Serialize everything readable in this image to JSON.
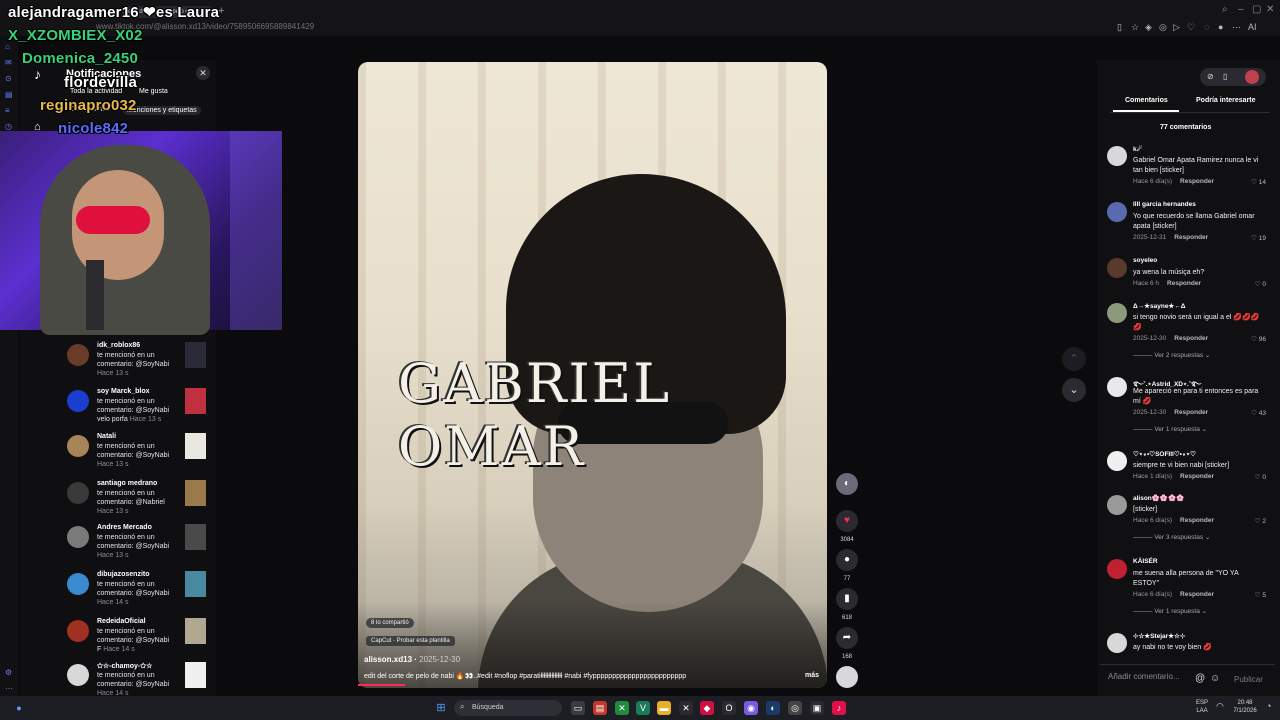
{
  "browser": {
    "url": "www.tiktok.com/@alisson.xd13/video/7589506695889841429",
    "tab_label": "edit del corte de pelo de",
    "new_tab": "+"
  },
  "chat_overlay": [
    {
      "name": "alejandragamer16 ❤es Laura",
      "color": "#ffffff"
    },
    {
      "name": "X_XZOMBIEX_X02",
      "color": "#38d27a"
    },
    {
      "name": "Domenica_2450",
      "color": "#38d27a"
    },
    {
      "name": "flordevilla",
      "color": "#ffffff"
    },
    {
      "name": "reginapro032",
      "color": "#e8b84a"
    },
    {
      "name": "nicole842",
      "color": "#5b6cff"
    }
  ],
  "notifications": {
    "title": "Notificaciones",
    "filters": [
      "Toda la actividad",
      "Me gusta",
      "Comentarios",
      "Menciones y etiquetas"
    ],
    "items": [
      {
        "name": "idk_roblox86",
        "text": "te mencionó en un comentario: @SoyNabi",
        "time": "Hace 13 s",
        "avatar": "#6b3b2a",
        "thumb": "#2a2a38"
      },
      {
        "name": "soy Marck_blox",
        "text": "te mencionó en un comentario: @SoyNabi velo porfa",
        "time": "Hace 13 s",
        "avatar": "#1a3fd0",
        "thumb": "#c03040"
      },
      {
        "name": "Natali",
        "text": "te mencionó en un comentario: @SoyNabi",
        "time": "Hace 13 s",
        "avatar": "#a8845a",
        "thumb": "#e8e8e0"
      },
      {
        "name": "santiago medrano",
        "text": "te mencionó en un comentario: @Nabriel",
        "time": "Hace 13 s",
        "avatar": "#3a3a3a",
        "thumb": "#9a7a4a"
      },
      {
        "name": "Andres Mercado",
        "text": "te mencionó en un comentario: @SoyNabi",
        "time": "Hace 13 s",
        "avatar": "#7a7a7a",
        "thumb": "#4a4a4a"
      },
      {
        "name": "dibujazosenzito",
        "text": "te mencionó en un comentario: @SoyNabi",
        "time": "Hace 14 s",
        "avatar": "#3a8ad0",
        "thumb": "#4a8aa0"
      },
      {
        "name": "RedeidaOficial",
        "text": "te mencionó en un comentario: @SoyNabi F",
        "time": "Hace 14 s",
        "avatar": "#a03020",
        "thumb": "#b0a890"
      },
      {
        "name": "✩☆-chamoy-✩☆",
        "text": "te mencionó en un comentario: @SoyNabi",
        "time": "Hace 14 s",
        "avatar": "#d8d8d8",
        "thumb": "#f0f0f0"
      }
    ]
  },
  "video": {
    "overlay_title": "GABRIEL OMAR",
    "shared_label": "8 lo compartió",
    "capcut_label": "CapCut · Probar esta plantilla",
    "author": "alisson.xd13",
    "date": "2025-12-30",
    "description": "edit del corte de pelo de nabi 🔥👀..#edit #noflop #paratiłłłłłłłłłłłłłł #nabi #fypppppppppppppppppppppppp",
    "more": "más",
    "progress": 0.1
  },
  "actions": {
    "likes": "3084",
    "comments": "77",
    "saves": "618",
    "shares": "168"
  },
  "comments_panel": {
    "tab_comments": "Comentarios",
    "tab_related": "Podría interesarte",
    "count_label": "77 comentarios",
    "input_placeholder": "Añadir comentario...",
    "publish": "Publicar",
    "reply_label": "Responder",
    "items": [
      {
        "user": "k☄",
        "text": "Gabriel Omar Apata Ramirez nunca le vi tan bien [sticker]",
        "meta": "Hace 6 día(s)",
        "likes": "14",
        "avatar": "#d8d8dc"
      },
      {
        "user": "llll garcia hernandes",
        "text": "Yo que recuerdo se llama Gabriel omar apata [sticker]",
        "meta": "2025-12-31",
        "likes": "19",
        "avatar": "#5a6ab0"
      },
      {
        "user": "soyeleo",
        "text": "ya wena la músiça eh?",
        "meta": "Hace 6 h",
        "likes": "0",
        "avatar": "#5a3a2a"
      },
      {
        "user": "Δ→★sayne★←Δ",
        "text": "si tengo novio será un igual a el 💋💋💋💋",
        "meta": "2025-12-30",
        "likes": "96",
        "avatar": "#8a9a7a",
        "more": "Ver 2 respuestas"
      },
      {
        "user": "࿐˚.⋆Astrid_XD⋆.˚࿐",
        "text": "Me apareció en para ti entonces es para mí 💋",
        "meta": "2025-12-30",
        "likes": "43",
        "avatar": "#e8e8ec",
        "more": "Ver 1 respuesta"
      },
      {
        "user": "♡⋆∘•♡SOFIII♡•∘⋆♡",
        "text": "siempre te vi bien nabi [sticker]",
        "meta": "Hace 1 día(s)",
        "likes": "0",
        "avatar": "#f0f0f0"
      },
      {
        "user": "alison🌸🌸🌸🌸",
        "text": "[sticker]",
        "meta": "Hace 6 día(s)",
        "likes": "2",
        "avatar": "#9a9a9a",
        "more": "Ver 3 respuestas"
      },
      {
        "user": "KÄISÉR",
        "text": "me suena alla persona de \"YO YA ESTOY\"",
        "meta": "Hace 6 día(s)",
        "likes": "5",
        "avatar": "#c02030",
        "more": "Ver 1 respuesta"
      },
      {
        "user": "⊹☆★Stejar★☆⊹",
        "text": "ay nabi no te voy bien 💋",
        "meta": "",
        "likes": "",
        "avatar": "#d8d8d8"
      }
    ]
  },
  "taskbar": {
    "search_label": "Búsqueda",
    "lang": "ESP LAA",
    "time": "20:48",
    "date": "7/1/2026"
  },
  "colors": {
    "accent": "#fe2c55",
    "bg": "#0b0b0e",
    "panel": "#101013"
  }
}
